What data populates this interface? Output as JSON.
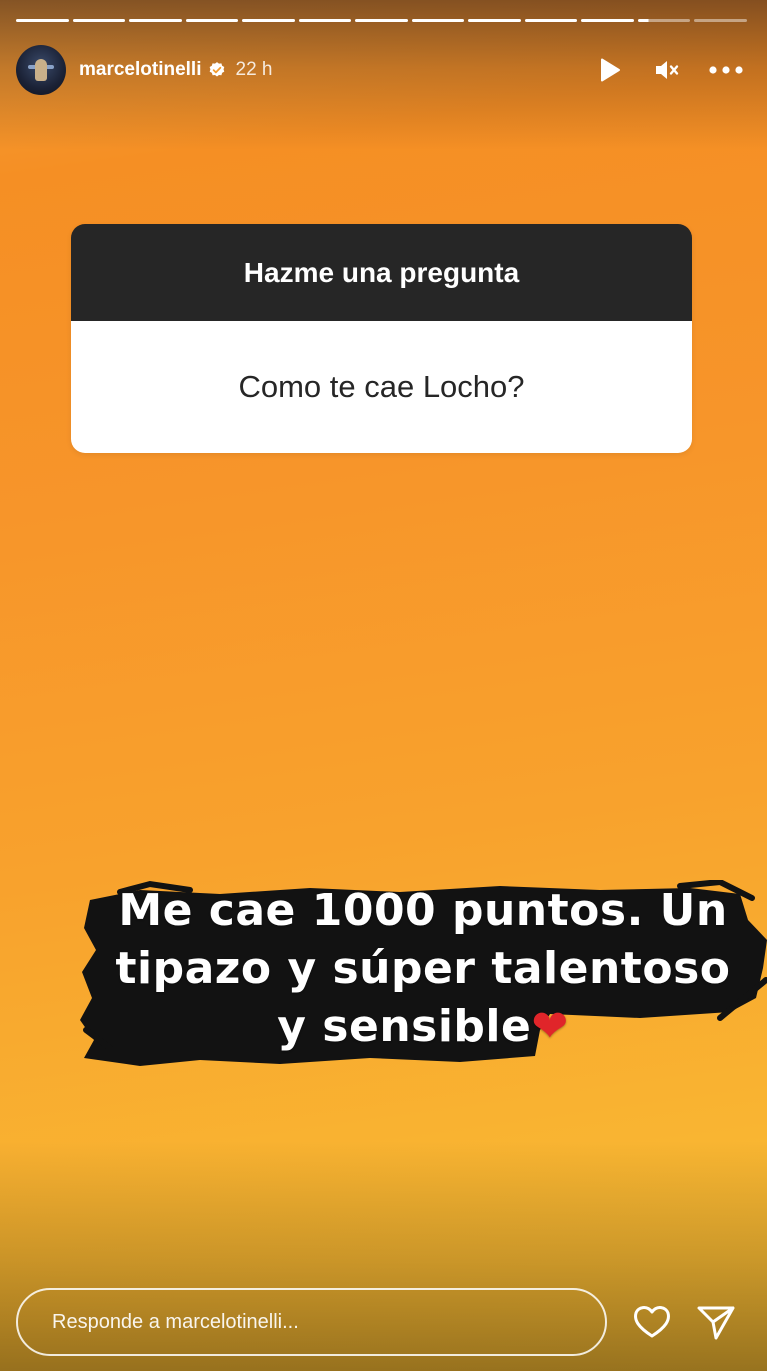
{
  "story": {
    "segments_total": 13,
    "segments_done": 11,
    "author": {
      "username": "marcelotinelli",
      "verified": true,
      "time_ago": "22 h"
    },
    "header_actions": [
      "play-icon",
      "mute-icon",
      "more-icon"
    ],
    "question_sticker": {
      "title": "Hazme una pregunta",
      "question": "Como te cae Locho?"
    },
    "answer_text": "Me cae 1000 puntos. Un tipazo y súper talentoso y sensible",
    "answer_emoji": "❤",
    "reply": {
      "placeholder": "Responde a marcelotinelli..."
    },
    "footer_actions": [
      "heart-icon",
      "send-icon"
    ],
    "colors": {
      "background_top": "#f58f24",
      "background_bottom": "#fbc238",
      "sticker_header": "#262626",
      "sticker_body": "#ffffff",
      "heart": "#e0252a"
    }
  }
}
